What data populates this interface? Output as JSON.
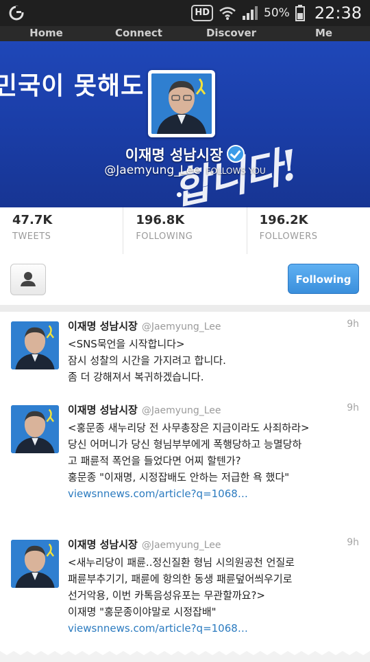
{
  "status_bar": {
    "hd": "HD",
    "battery": "50%",
    "time": "22:38"
  },
  "nav": {
    "tabs": [
      "Home",
      "Connect",
      "Discover",
      "Me"
    ]
  },
  "profile": {
    "banner_text": "민국이 못해도",
    "banner_brush": "합니다!",
    "name": "이재명 성남시장",
    "handle": "@Jaemyung_Lee",
    "follows_you": "FOLLOWS YOU"
  },
  "stats": [
    {
      "value": "47.7K",
      "label": "TWEETS"
    },
    {
      "value": "196.8K",
      "label": "FOLLOWING"
    },
    {
      "value": "196.2K",
      "label": "FOLLOWERS"
    }
  ],
  "actions": {
    "following_label": "Following"
  },
  "tweets": [
    {
      "name": "이재명 성남시장",
      "handle": "@Jaemyung_Lee",
      "time": "9h",
      "text": "<SNS묵언을 시작합니다>\n잠시 성찰의 시간을 가지려고 합니다.\n좀 더 강해져서 복귀하겠습니다.",
      "link": ""
    },
    {
      "name": "이재명 성남시장",
      "handle": "@Jaemyung_Lee",
      "time": "9h",
      "text": "<홍문종 새누리당 전 사무총장은 지금이라도 사죄하라>\n당신 어머니가 당신 형님부부에게 폭행당하고 능멸당하\n고 패륜적 폭언을 들었다면 어찌 할텐가?\n홍문종 \"이재명, 시정잡배도 안하는 저급한 욕 했다\"",
      "link": "viewsnnews.com/article?q=1068…"
    },
    {
      "name": "이재명 성남시장",
      "handle": "@Jaemyung_Lee",
      "time": "9h",
      "text": "<새누리당이 패륜..정신질환 형님 시의원공천 언질로\n패륜부추기기, 패륜에 항의한 동생 패륜덮어씌우기로\n선거악용, 이번 카톡음성유포는 무관할까요?>\n이재명 \"홍문종이야말로 시정잡배\"",
      "link": "viewsnnews.com/article?q=1068…"
    }
  ],
  "colors": {
    "banner_blue": "#1f47b8",
    "link": "#2a7abf",
    "button": "#3a8fdc"
  }
}
